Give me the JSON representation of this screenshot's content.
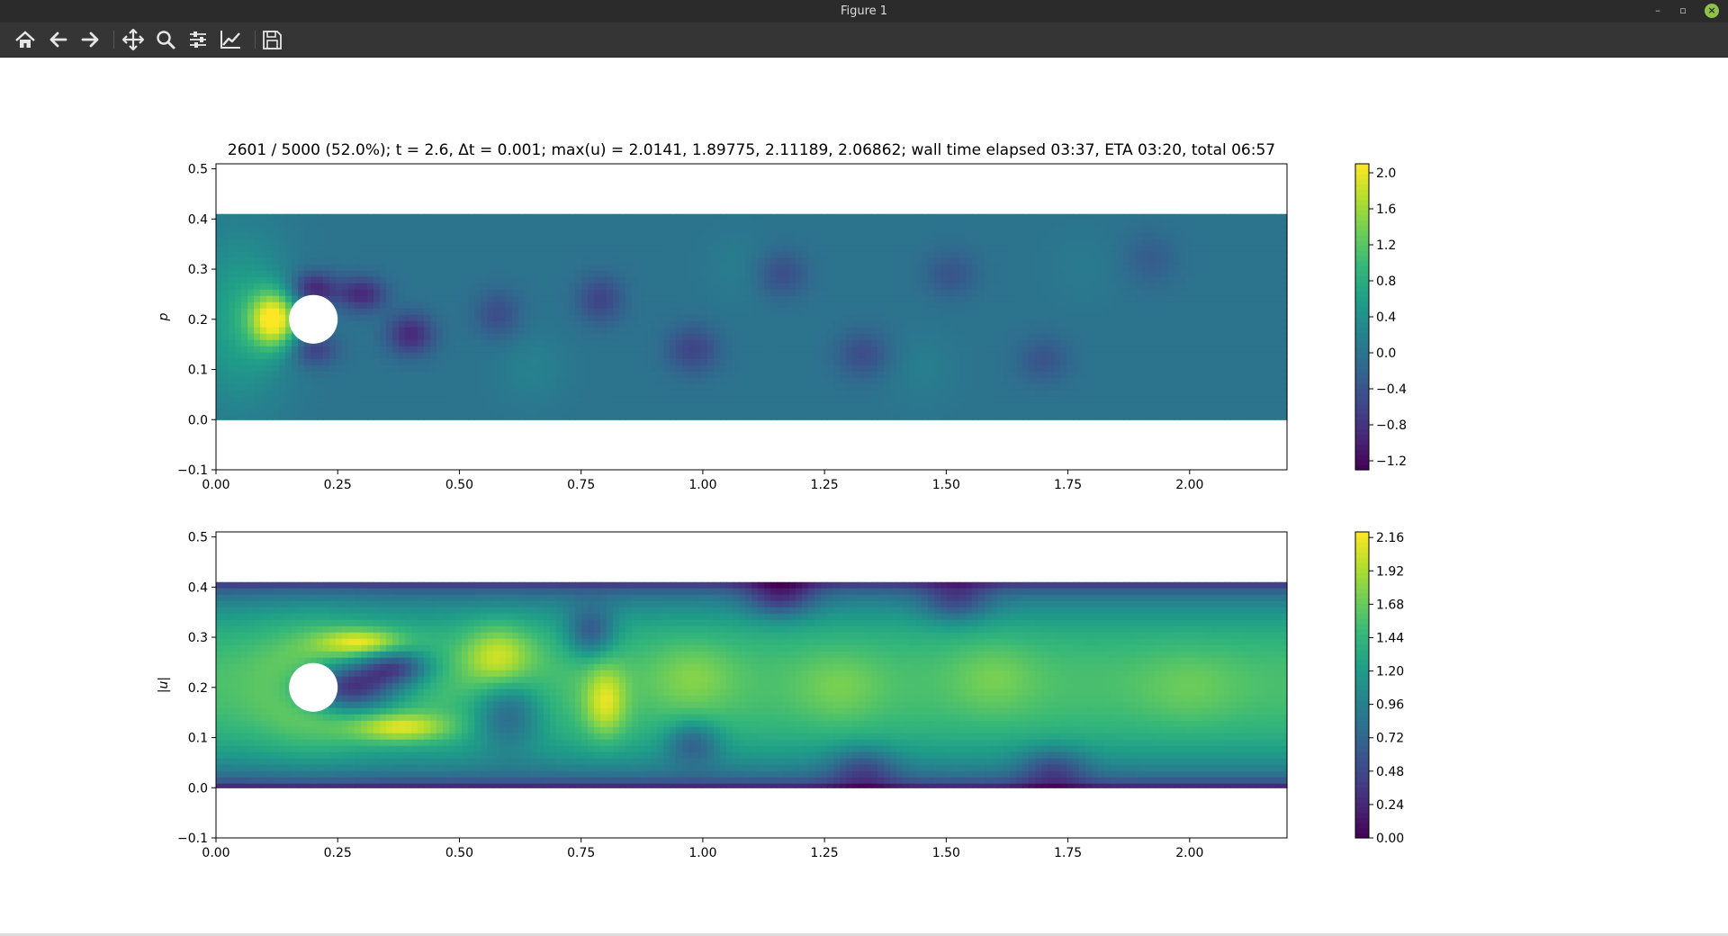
{
  "window": {
    "title": "Figure 1",
    "minimize_glyph": "–",
    "restore_glyph": "▫",
    "close_glyph": "×"
  },
  "toolbar": {
    "buttons": [
      {
        "name": "home-button",
        "icon": "home-icon"
      },
      {
        "name": "back-button",
        "icon": "arrow-left-icon"
      },
      {
        "name": "forward-button",
        "icon": "arrow-right-icon"
      },
      {
        "name": "pan-button",
        "icon": "move-icon"
      },
      {
        "name": "zoom-button",
        "icon": "magnifier-icon"
      },
      {
        "name": "subplots-button",
        "icon": "sliders-icon"
      },
      {
        "name": "edit-axes-button",
        "icon": "line-chart-icon"
      },
      {
        "name": "save-button",
        "icon": "floppy-disk-icon"
      }
    ]
  },
  "figure": {
    "title": "2601 / 5000 (52.0%); t = 2.6, Δt = 0.001; max(u) = 2.0141, 1.89775, 2.11189, 2.06862; wall time elapsed 03:37, ETA 03:20, total 06:57"
  },
  "chart_data": [
    {
      "type": "heatmap",
      "title": "",
      "ylabel": "p",
      "xlabel": "",
      "xlim": [
        0.0,
        2.2
      ],
      "ylim": [
        -0.1,
        0.51
      ],
      "domain": {
        "x": [
          0.0,
          2.2
        ],
        "y": [
          0.0,
          0.41
        ]
      },
      "obstacle": {
        "shape": "circle",
        "cx": 0.2,
        "cy": 0.2,
        "r": 0.05
      },
      "x_ticks": [
        "0.00",
        "0.25",
        "0.50",
        "0.75",
        "1.00",
        "1.25",
        "1.50",
        "1.75",
        "2.00"
      ],
      "x_tick_values": [
        0.0,
        0.25,
        0.5,
        0.75,
        1.0,
        1.25,
        1.5,
        1.75,
        2.0
      ],
      "y_ticks": [
        "−0.1",
        "0.0",
        "0.1",
        "0.2",
        "0.3",
        "0.4",
        "0.5"
      ],
      "y_tick_values": [
        -0.1,
        0.0,
        0.1,
        0.2,
        0.3,
        0.4,
        0.5
      ],
      "colorbar": {
        "colormap": "viridis",
        "range": [
          -1.3,
          2.1
        ],
        "ticks": [
          "2.0",
          "1.6",
          "1.2",
          "0.8",
          "0.4",
          "0.0",
          "−0.4",
          "−0.8",
          "−1.2"
        ],
        "tick_values": [
          2.0,
          1.6,
          1.2,
          0.8,
          0.4,
          0.0,
          -0.4,
          -0.8,
          -1.2
        ]
      },
      "background_value": 0.0,
      "features": [
        {
          "x": 0.12,
          "y": 0.2,
          "sx": 0.035,
          "sy": 0.04,
          "v": 1.9
        },
        {
          "x": 0.05,
          "y": 0.2,
          "sx": 0.07,
          "sy": 0.12,
          "v": 0.7
        },
        {
          "x": 0.2,
          "y": 0.26,
          "sx": 0.035,
          "sy": 0.025,
          "v": -1.0
        },
        {
          "x": 0.2,
          "y": 0.14,
          "sx": 0.035,
          "sy": 0.025,
          "v": -0.7
        },
        {
          "x": 0.3,
          "y": 0.25,
          "sx": 0.035,
          "sy": 0.025,
          "v": -0.9
        },
        {
          "x": 0.4,
          "y": 0.17,
          "sx": 0.035,
          "sy": 0.03,
          "v": -0.9
        },
        {
          "x": 0.58,
          "y": 0.21,
          "sx": 0.035,
          "sy": 0.035,
          "v": -0.5
        },
        {
          "x": 0.79,
          "y": 0.24,
          "sx": 0.035,
          "sy": 0.035,
          "v": -0.6
        },
        {
          "x": 0.98,
          "y": 0.14,
          "sx": 0.04,
          "sy": 0.035,
          "v": -0.6
        },
        {
          "x": 1.16,
          "y": 0.29,
          "sx": 0.04,
          "sy": 0.035,
          "v": -0.5
        },
        {
          "x": 1.33,
          "y": 0.13,
          "sx": 0.04,
          "sy": 0.035,
          "v": -0.5
        },
        {
          "x": 1.51,
          "y": 0.29,
          "sx": 0.04,
          "sy": 0.035,
          "v": -0.4
        },
        {
          "x": 1.7,
          "y": 0.12,
          "sx": 0.04,
          "sy": 0.035,
          "v": -0.4
        },
        {
          "x": 1.92,
          "y": 0.32,
          "sx": 0.04,
          "sy": 0.04,
          "v": -0.3
        },
        {
          "x": 0.65,
          "y": 0.1,
          "sx": 0.05,
          "sy": 0.05,
          "v": 0.2
        },
        {
          "x": 1.08,
          "y": 0.3,
          "sx": 0.05,
          "sy": 0.05,
          "v": 0.15
        },
        {
          "x": 1.45,
          "y": 0.1,
          "sx": 0.05,
          "sy": 0.05,
          "v": 0.15
        },
        {
          "x": 1.78,
          "y": 0.3,
          "sx": 0.05,
          "sy": 0.05,
          "v": 0.1
        }
      ]
    },
    {
      "type": "heatmap",
      "title": "",
      "ylabel": "|u|",
      "xlabel": "",
      "xlim": [
        0.0,
        2.2
      ],
      "ylim": [
        -0.1,
        0.51
      ],
      "domain": {
        "x": [
          0.0,
          2.2
        ],
        "y": [
          0.0,
          0.41
        ]
      },
      "obstacle": {
        "shape": "circle",
        "cx": 0.2,
        "cy": 0.2,
        "r": 0.05
      },
      "x_ticks": [
        "0.00",
        "0.25",
        "0.50",
        "0.75",
        "1.00",
        "1.25",
        "1.50",
        "1.75",
        "2.00"
      ],
      "x_tick_values": [
        0.0,
        0.25,
        0.5,
        0.75,
        1.0,
        1.25,
        1.5,
        1.75,
        2.0
      ],
      "y_ticks": [
        "−0.1",
        "0.0",
        "0.1",
        "0.2",
        "0.3",
        "0.4",
        "0.5"
      ],
      "y_tick_values": [
        -0.1,
        0.0,
        0.1,
        0.2,
        0.3,
        0.4,
        0.5
      ],
      "colorbar": {
        "colormap": "viridis",
        "range": [
          0.0,
          2.2
        ],
        "ticks": [
          "2.16",
          "1.92",
          "1.68",
          "1.44",
          "1.20",
          "0.96",
          "0.72",
          "0.48",
          "0.24",
          "0.00"
        ],
        "tick_values": [
          2.16,
          1.92,
          1.68,
          1.44,
          1.2,
          0.96,
          0.72,
          0.48,
          0.24,
          0.0
        ]
      },
      "background_value": 1.55,
      "wall_profile": "parabolic",
      "features": [
        {
          "x": 0.27,
          "y": 0.2,
          "sx": 0.07,
          "sy": 0.035,
          "v": -1.4
        },
        {
          "x": 0.37,
          "y": 0.24,
          "sx": 0.05,
          "sy": 0.025,
          "v": -0.9
        },
        {
          "x": 0.3,
          "y": 0.29,
          "sx": 0.06,
          "sy": 0.018,
          "v": 0.7
        },
        {
          "x": 0.38,
          "y": 0.12,
          "sx": 0.07,
          "sy": 0.02,
          "v": 0.7
        },
        {
          "x": 0.58,
          "y": 0.26,
          "sx": 0.05,
          "sy": 0.045,
          "v": 0.6
        },
        {
          "x": 0.8,
          "y": 0.17,
          "sx": 0.03,
          "sy": 0.05,
          "v": 0.6
        },
        {
          "x": 0.6,
          "y": 0.15,
          "sx": 0.05,
          "sy": 0.05,
          "v": -0.7
        },
        {
          "x": 0.77,
          "y": 0.31,
          "sx": 0.035,
          "sy": 0.035,
          "v": -0.7
        },
        {
          "x": 0.98,
          "y": 0.09,
          "sx": 0.04,
          "sy": 0.03,
          "v": -0.6
        },
        {
          "x": 1.16,
          "y": 0.38,
          "sx": 0.05,
          "sy": 0.03,
          "v": -0.6
        },
        {
          "x": 1.33,
          "y": 0.04,
          "sx": 0.05,
          "sy": 0.03,
          "v": -0.5
        },
        {
          "x": 1.52,
          "y": 0.37,
          "sx": 0.05,
          "sy": 0.03,
          "v": -0.5
        },
        {
          "x": 1.72,
          "y": 0.04,
          "sx": 0.05,
          "sy": 0.03,
          "v": -0.5
        },
        {
          "x": 0.98,
          "y": 0.22,
          "sx": 0.06,
          "sy": 0.05,
          "v": 0.25
        },
        {
          "x": 1.28,
          "y": 0.2,
          "sx": 0.06,
          "sy": 0.05,
          "v": 0.2
        },
        {
          "x": 1.6,
          "y": 0.22,
          "sx": 0.06,
          "sy": 0.05,
          "v": 0.2
        },
        {
          "x": 2.0,
          "y": 0.2,
          "sx": 0.07,
          "sy": 0.05,
          "v": 0.15
        },
        {
          "x": 0.2,
          "y": 0.2,
          "sx": 0.08,
          "sy": 0.09,
          "v": 0.35
        }
      ]
    }
  ]
}
